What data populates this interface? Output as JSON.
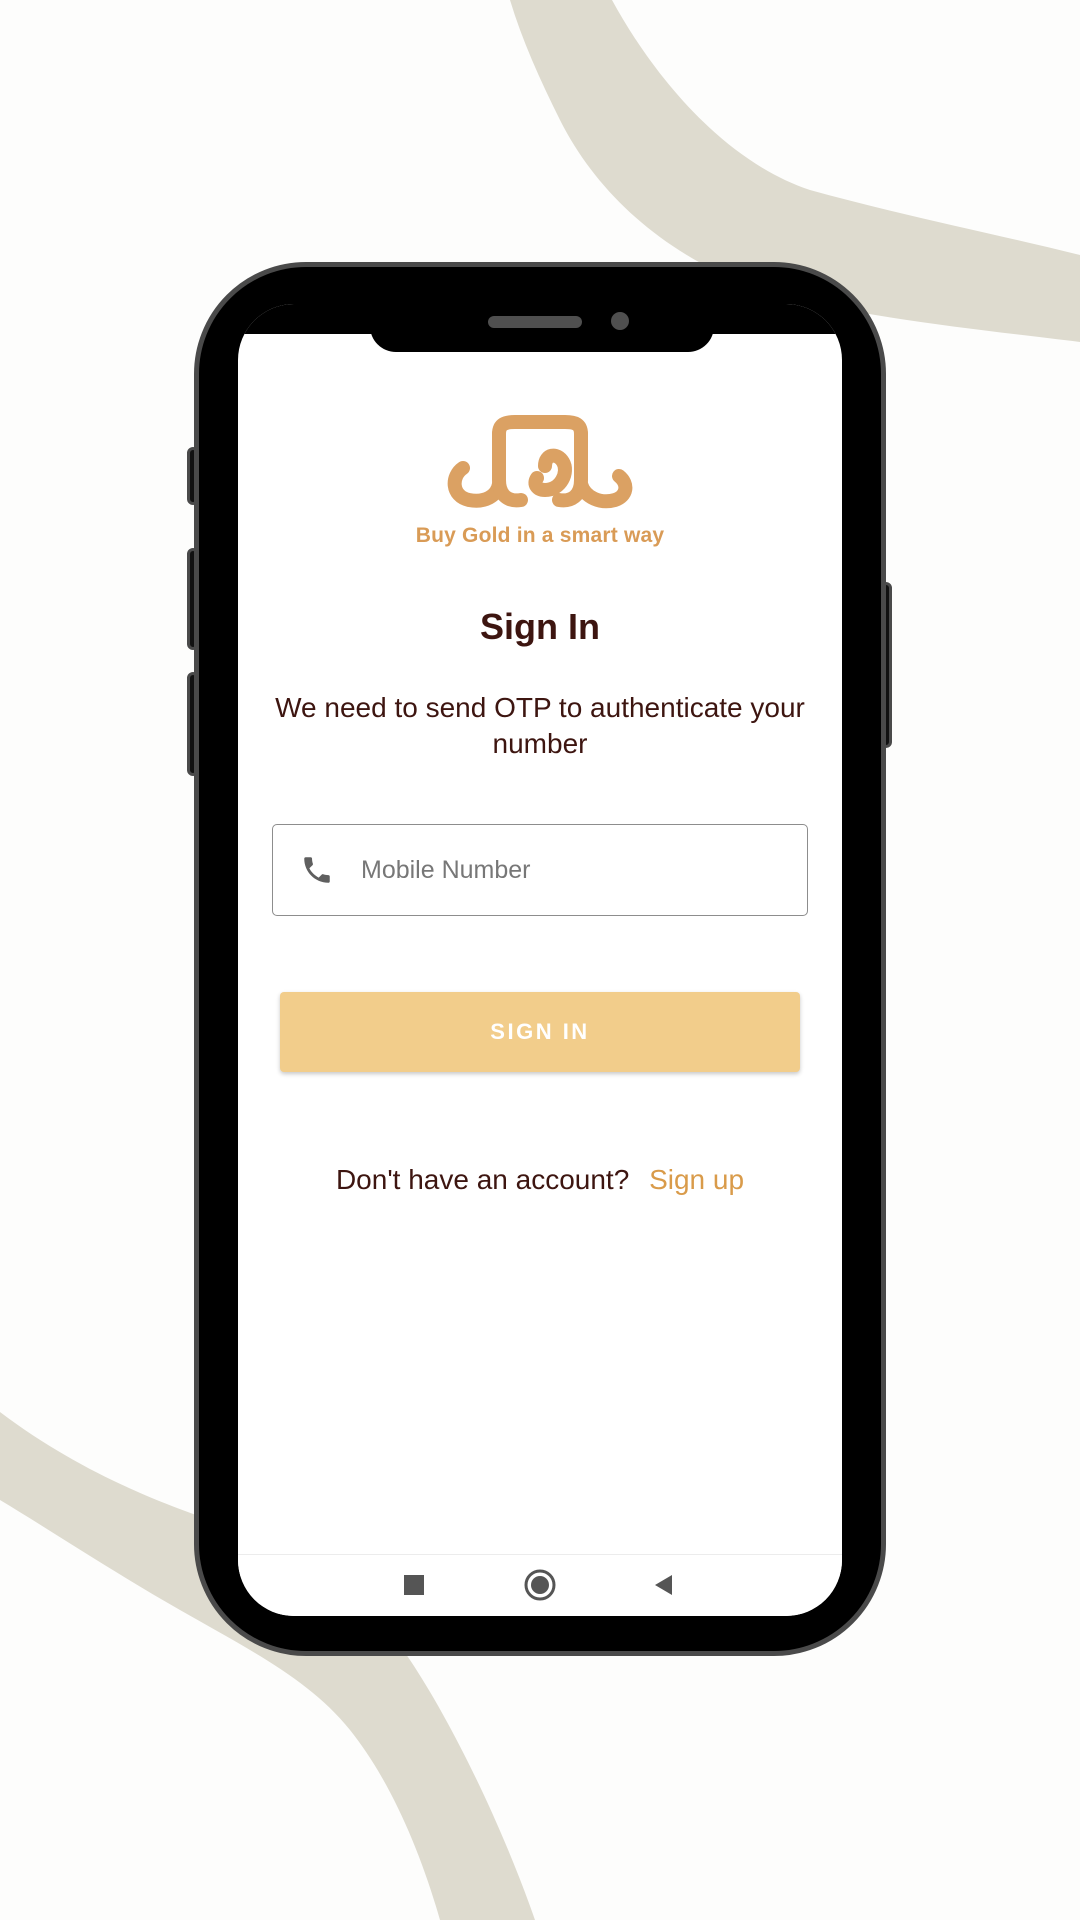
{
  "brand": {
    "tagline": "Buy Gold in a smart way",
    "logo_color": "#dba163",
    "tagline_color": "#d99b56"
  },
  "signin": {
    "title": "Sign In",
    "subtitle": "We need to send OTP to authenticate your number",
    "mobile_field": {
      "placeholder": "Mobile Number",
      "value": "",
      "icon": "phone-icon"
    },
    "button_label": "SIGN IN",
    "button_color": "#f2cd8b",
    "no_account_text": "Don't have an account?",
    "signup_link": "Sign up",
    "link_color": "#d99b4a",
    "text_color": "#3d1510"
  },
  "navbar": {
    "recents_icon": "square-icon",
    "home_icon": "circle-icon",
    "back_icon": "triangle-back-icon"
  }
}
